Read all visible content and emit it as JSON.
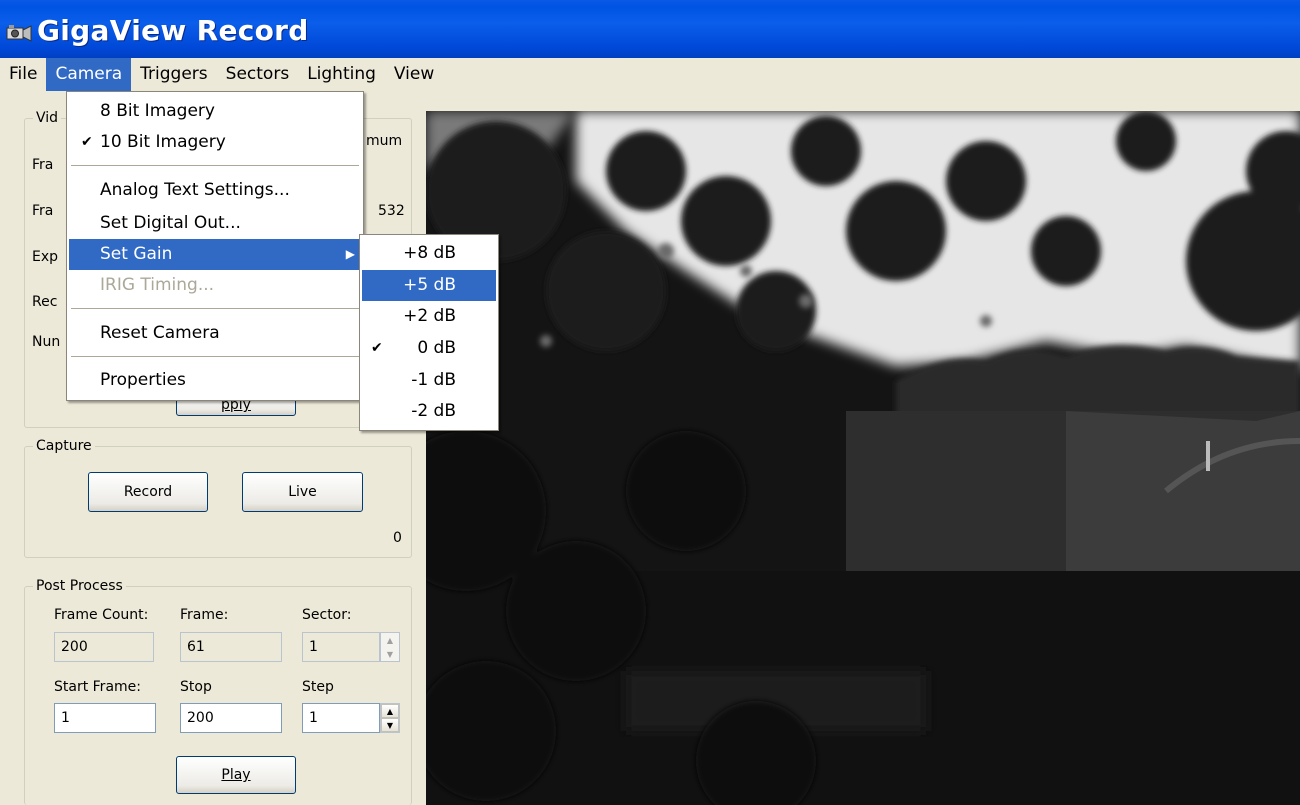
{
  "window": {
    "title": "GigaView Record"
  },
  "menubar": [
    "File",
    "Camera",
    "Triggers",
    "Sectors",
    "Lighting",
    "View"
  ],
  "camera_menu": {
    "items": [
      {
        "label": "8 Bit Imagery"
      },
      {
        "label": "10 Bit Imagery",
        "checked": true
      },
      {
        "label": "Analog Text Settings..."
      },
      {
        "label": "Set Digital Out..."
      },
      {
        "label": "Set Gain",
        "submenu": true,
        "highlighted": true
      },
      {
        "label": "IRIG Timing...",
        "disabled": true
      },
      {
        "label": "Reset Camera"
      },
      {
        "label": "Properties"
      }
    ]
  },
  "gain_submenu": {
    "items": [
      {
        "label": "+8 dB"
      },
      {
        "label": "+5 dB",
        "highlighted": true
      },
      {
        "label": "+2 dB"
      },
      {
        "label": "0 dB",
        "checked": true
      },
      {
        "label": "-1 dB"
      },
      {
        "label": "-2 dB"
      }
    ]
  },
  "video_group": {
    "legend": "Vid",
    "rows": [
      "Fra",
      "Fra",
      "Exp",
      "Rec",
      "Nun"
    ],
    "maximum_fragment": "mum",
    "value_fragment": "532",
    "apply_fragment": "pply"
  },
  "capture_group": {
    "legend": "Capture",
    "record_button": "Record",
    "live_button": "Live",
    "counter": "0"
  },
  "post_process": {
    "legend": "Post Process",
    "frame_count_label": "Frame Count:",
    "frame_label": "Frame:",
    "sector_label": "Sector:",
    "frame_count_value": "200",
    "frame_value": "61",
    "sector_value": "1",
    "start_frame_label": "Start Frame:",
    "stop_label": "Stop",
    "step_label": "Step",
    "start_frame_value": "1",
    "stop_value": "200",
    "step_value": "1",
    "play_button": "Play"
  },
  "colors": {
    "titlebar": "#0054E3",
    "menu_highlight": "#316AC5",
    "window_bg": "#ECE9D8",
    "video_bg": "#151515"
  }
}
